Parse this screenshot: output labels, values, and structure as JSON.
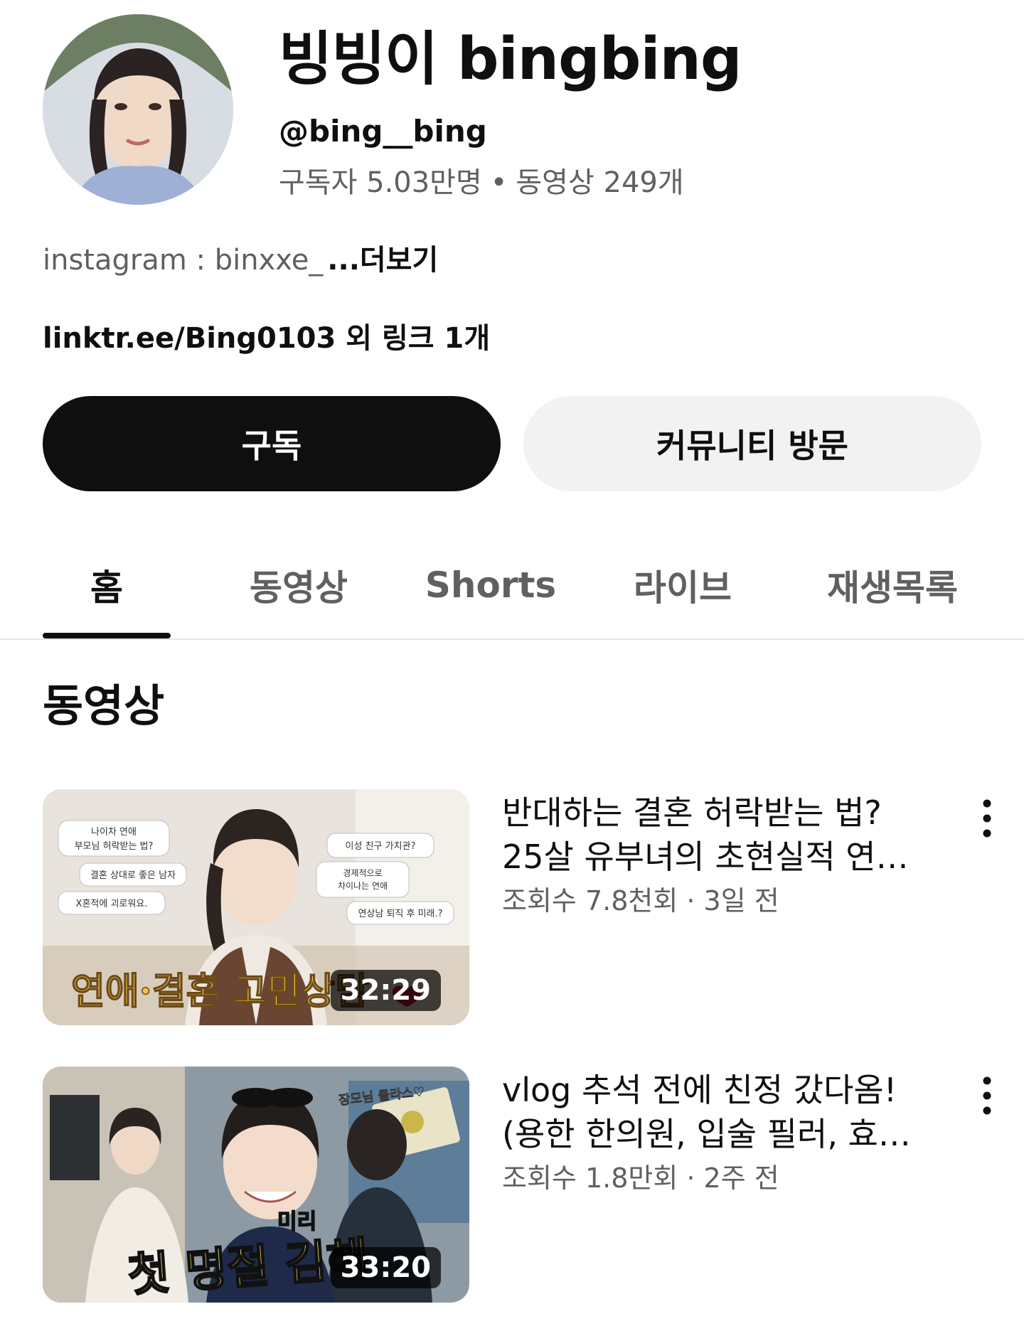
{
  "channel": {
    "name": "빙빙이 bingbing",
    "handle": "@bing__bing",
    "subscribers": "구독자 5.03만명",
    "separator": "•",
    "videos_count": "동영상 249개",
    "description": "instagram : binxxe_",
    "more_label": "...더보기",
    "links": "linktr.ee/Bing0103 외 링크 1개"
  },
  "buttons": {
    "subscribe": "구독",
    "community": "커뮤니티 방문"
  },
  "tabs": [
    {
      "label": "홈",
      "active": true
    },
    {
      "label": "동영상",
      "active": false
    },
    {
      "label": "Shorts",
      "active": false
    },
    {
      "label": "라이브",
      "active": false
    },
    {
      "label": "재생목록",
      "active": false
    }
  ],
  "section": {
    "title": "동영상"
  },
  "videos": [
    {
      "title_line1": "반대하는 결혼 허락받는 법?",
      "title_line2": "25살 유부녀의 초현실적 연…",
      "meta": "조회수 7.8천회 · 3일 전",
      "duration": "32:29",
      "thumb_text": {
        "bubble1": "나이차 연애 부모님 허락받는 법?",
        "bubble2": "결혼 상대로 좋은 남자",
        "bubble3": "X혼적에 괴로워요.",
        "bubble4": "이성 친구 가치관?",
        "bubble5": "경제적으로 차이나는 연애",
        "bubble6": "연상남 퇴직 후 미래.?",
        "caption": "연애·결혼 고민상담"
      }
    },
    {
      "title_line1": "vlog 추석 전에 친정 갔다옴!",
      "title_line2": "(용한 한의원, 입술 필러, 효…",
      "meta": "조회수 1.8만회 · 2주 전",
      "duration": "33:20",
      "thumb_text": {
        "tag": "장모님 클라스♡",
        "small": "미리",
        "caption": "첫 명절 김해"
      }
    }
  ],
  "icons": {
    "more": "more-vert-icon"
  },
  "colors": {
    "text_primary": "#0f0f0f",
    "text_secondary": "#606060",
    "subscribe_bg": "#0f0f0f",
    "community_bg": "#f2f2f2",
    "caption_gold": "#f5c542"
  }
}
